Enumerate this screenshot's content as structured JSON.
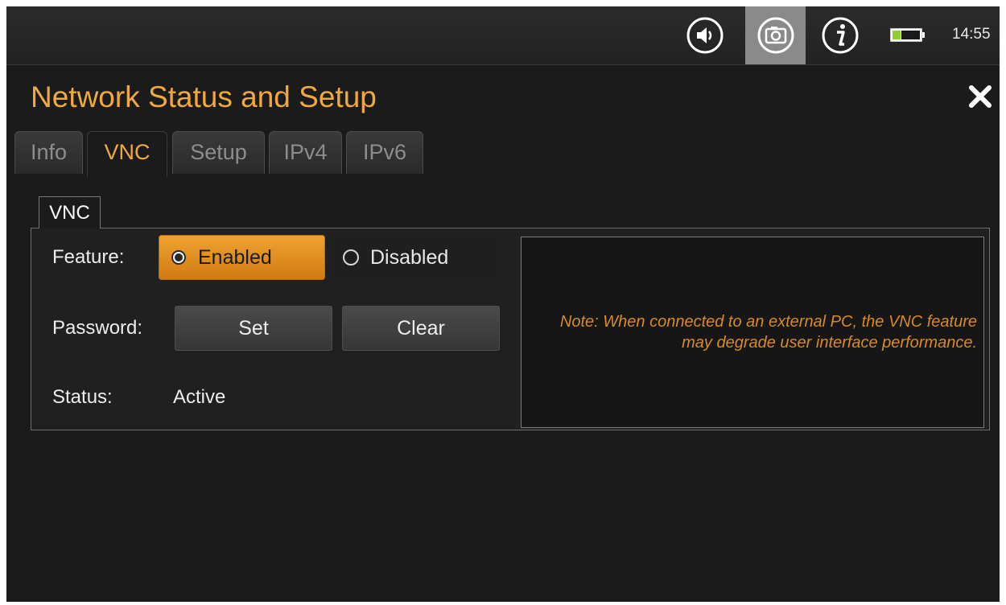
{
  "statusbar": {
    "icons": [
      "speaker-icon",
      "camera-icon",
      "info-icon",
      "battery-icon"
    ],
    "time": "14:55"
  },
  "dialog": {
    "title": "Network Status and Setup",
    "close_icon": "close-icon",
    "tabs": [
      {
        "label": "Info",
        "active": false
      },
      {
        "label": "VNC",
        "active": true
      },
      {
        "label": "Setup",
        "active": false
      },
      {
        "label": "IPv4",
        "active": false
      },
      {
        "label": "IPv6",
        "active": false
      }
    ]
  },
  "vnc_group": {
    "title": "VNC",
    "feature_label": "Feature:",
    "feature_options": {
      "enabled": "Enabled",
      "disabled": "Disabled",
      "selected": "Enabled"
    },
    "password_label": "Password:",
    "set_button": "Set",
    "clear_button": "Clear",
    "status_label": "Status:",
    "status_value": "Active",
    "note": "Note: When connected to an external PC, the VNC feature may degrade user interface performance."
  },
  "colors": {
    "accent": "#f2a93b",
    "background": "#1b1b1b",
    "note_text": "#d98a25"
  }
}
